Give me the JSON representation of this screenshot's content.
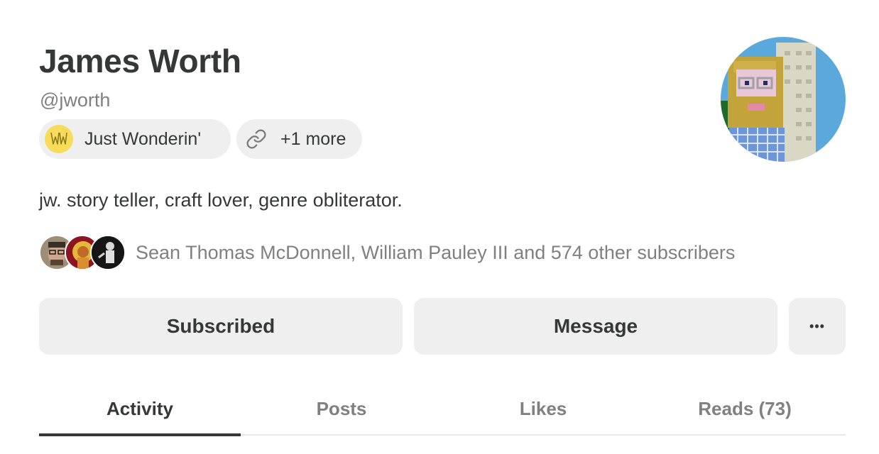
{
  "profile": {
    "name": "James Worth",
    "handle": "@jworth",
    "bio": "jw. story teller, craft lover, genre obliterator."
  },
  "chips": {
    "publication": "Just Wonderin'",
    "publication_logo_text": "JW",
    "more": "+1 more"
  },
  "subscribers": {
    "text": "Sean Thomas McDonnell, William Pauley III and 574 other subscribers"
  },
  "actions": {
    "subscribed": "Subscribed",
    "message": "Message",
    "more": "•••"
  },
  "tabs": [
    {
      "label": "Activity",
      "active": true
    },
    {
      "label": "Posts",
      "active": false
    },
    {
      "label": "Likes",
      "active": false
    },
    {
      "label": "Reads (73)",
      "active": false
    }
  ],
  "icons": {
    "link": "link-icon",
    "more": "ellipsis-icon"
  },
  "colors": {
    "chip_bg": "#efefef",
    "button_bg": "#efefef",
    "text_primary": "#363737",
    "text_secondary": "#808080",
    "pub_logo_bg": "#f7dc5a",
    "avatar_sky": "#5ba9dc"
  }
}
